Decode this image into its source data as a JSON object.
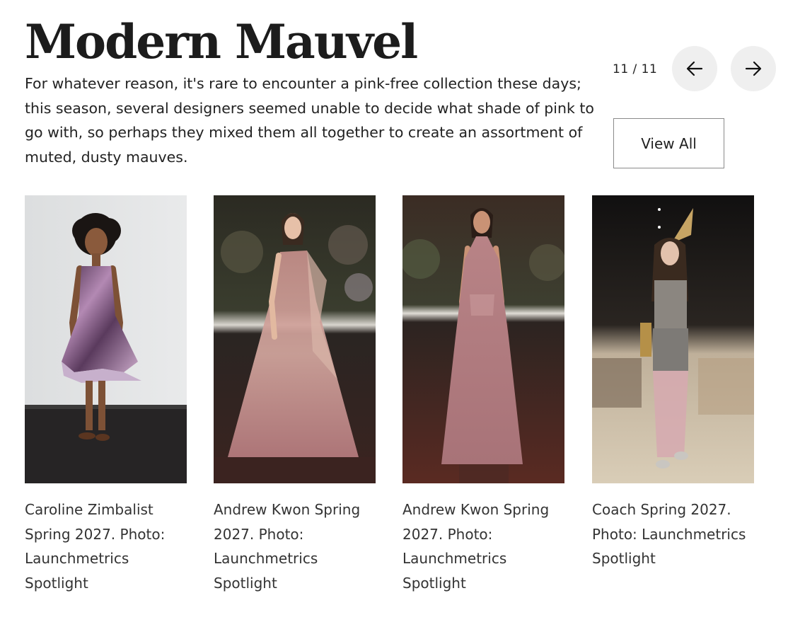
{
  "gallery": {
    "title": "Modern Mauvel",
    "description": "For whatever reason, it's rare to encounter a pink-free collection these days; this season, several designers seemed unable to decide what shade of pink to go with, so perhaps they mixed them all together to create an assortment of muted, dusty mauves.",
    "counter": "11 / 11",
    "view_all_label": "View All",
    "prev_icon": "arrow-left-icon",
    "next_icon": "arrow-right-icon"
  },
  "cards": [
    {
      "caption": "Caroline Zimbalist Spring 2027. Photo: Launchmetrics Spotlight"
    },
    {
      "caption": "Andrew Kwon Spring 2027. Photo: Launchmetrics Spotlight"
    },
    {
      "caption": "Andrew Kwon Spring 2027. Photo: Launchmetrics Spotlight"
    },
    {
      "caption": "Coach Spring 2027. Photo: Launchmetrics Spotlight"
    }
  ],
  "colors": {
    "text": "#1f1f1f",
    "nav_button_bg": "#efefef",
    "border": "#8a8a8a",
    "mauve": "#b98a9a"
  }
}
